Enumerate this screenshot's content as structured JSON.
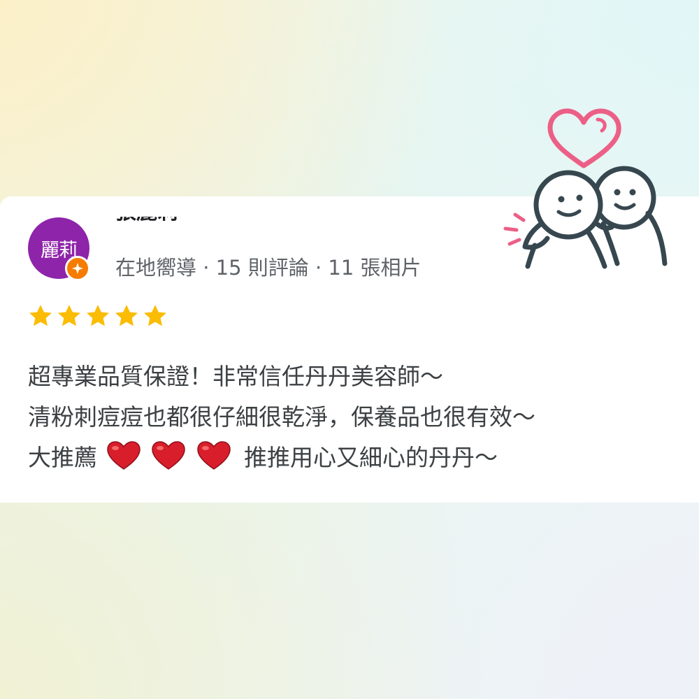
{
  "reviewer": {
    "avatar_text": "麗莉",
    "name": "張麗莉",
    "meta": "在地嚮導 · 15 則評論 · 11 張相片"
  },
  "rating": {
    "stars": 5,
    "max": 5
  },
  "review": {
    "line1": "超專業品質保證！非常信任丹丹美容師～",
    "line2": "清粉刺痘痘也都很仔細很乾淨，保養品也很有效～",
    "line3_before": "大推薦",
    "line3_after": "推推用心又細心的丹丹～"
  },
  "colors": {
    "avatar": "#8e24aa",
    "badge": "#f57c00",
    "star": "#fbbc04",
    "heart_emoji": "#d91e2b",
    "illustration_line": "#37474f",
    "illustration_accent": "#ec5f86"
  },
  "icons": {
    "badge": "local-guide-icon",
    "star": "star-icon",
    "heart": "red-heart-icon",
    "illustration": "hugging-friends-illustration"
  }
}
